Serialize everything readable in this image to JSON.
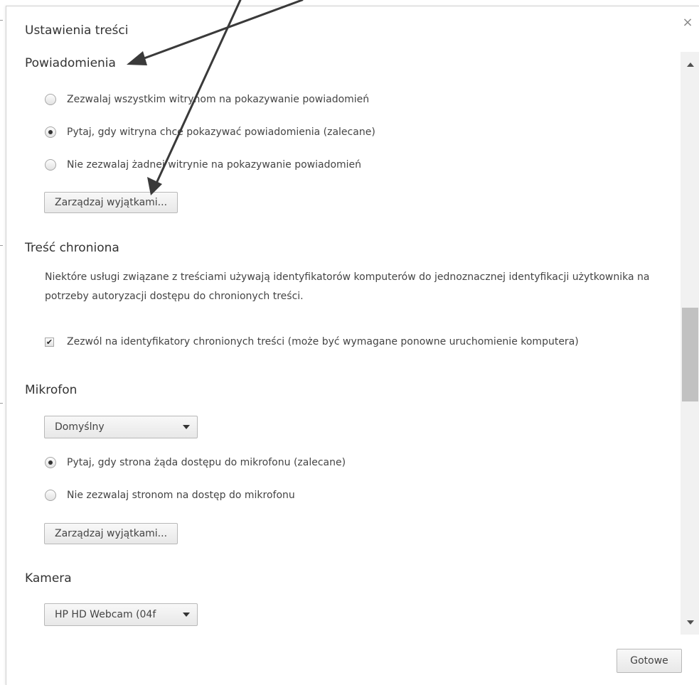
{
  "dialog": {
    "title": "Ustawienia treści",
    "close_symbol": "×",
    "done_label": "Gotowe"
  },
  "notifications": {
    "title": "Powiadomienia",
    "options": [
      {
        "label": "Zezwalaj wszystkim witrynom na pokazywanie powiadomień",
        "checked": false
      },
      {
        "label": "Pytaj, gdy witryna chce pokazywać powiadomienia (zalecane)",
        "checked": true
      },
      {
        "label": "Nie zezwalaj żadnej witrynie na pokazywanie powiadomień",
        "checked": false
      }
    ],
    "manage_label": "Zarządzaj wyjątkami..."
  },
  "protected": {
    "title": "Treść chroniona",
    "description": "Niektóre usługi związane z treściami używają identyfikatorów komputerów do jednoznacznej identyfikacji użytkownika na potrzeby autoryzacji dostępu do chronionych treści.",
    "checkbox_label": "Zezwól na identyfikatory chronionych treści (może być wymagane ponowne uruchomienie komputera)",
    "checkbox_checked": true,
    "check_symbol": "✔"
  },
  "microphone": {
    "title": "Mikrofon",
    "device": "Domyślny",
    "options": [
      {
        "label": "Pytaj, gdy strona żąda dostępu do mikrofonu (zalecane)",
        "checked": true
      },
      {
        "label": "Nie zezwalaj stronom na dostęp do mikrofonu",
        "checked": false
      }
    ],
    "manage_label": "Zarządzaj wyjątkami..."
  },
  "camera": {
    "title": "Kamera",
    "device": "HP HD Webcam (04f"
  },
  "colors": {
    "annotation_arrows": "#3a3a3a",
    "scrollbar_thumb": "#c1c1c1"
  }
}
